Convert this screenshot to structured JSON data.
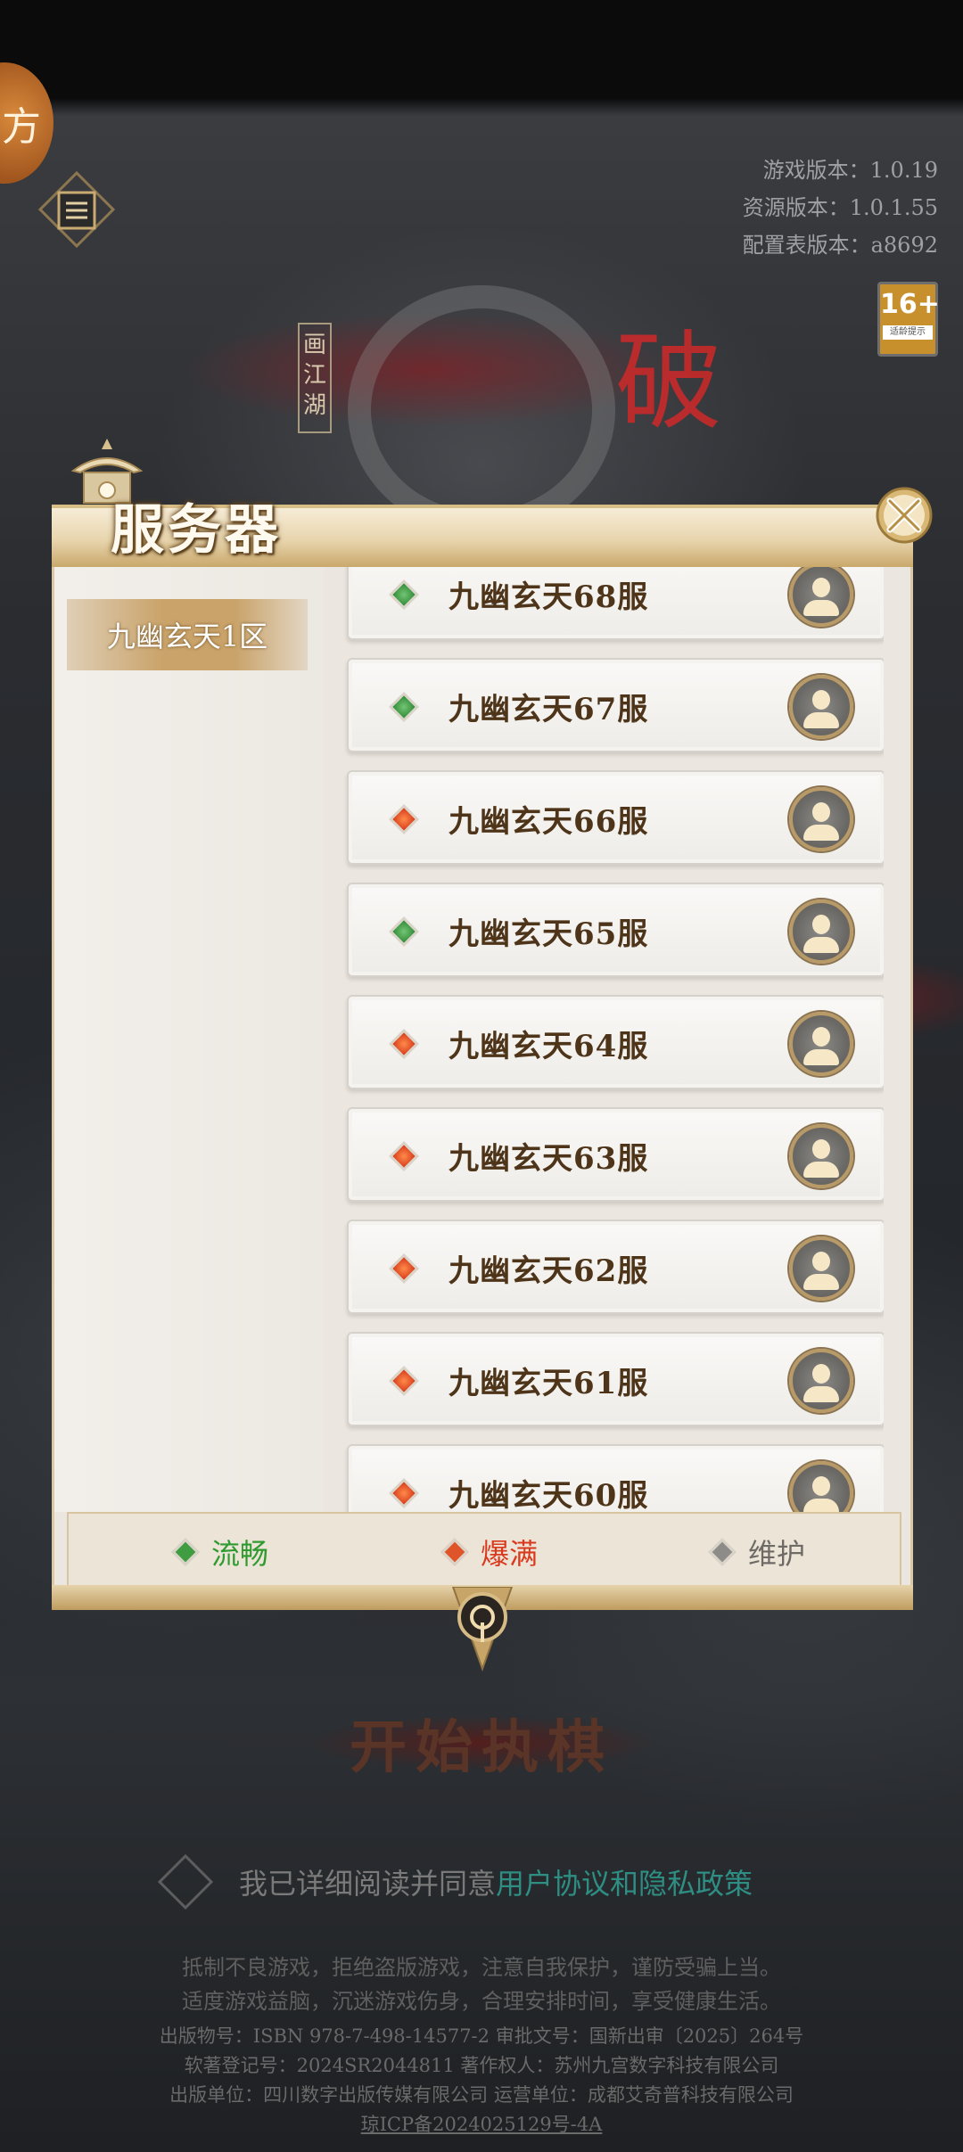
{
  "corner_badge": "方",
  "version": {
    "game": "游戏版本：1.0.19",
    "resource": "资源版本：1.0.1.55",
    "config": "配置表版本：a8692"
  },
  "age_rating": {
    "label": "16+",
    "tip": "适龄提示"
  },
  "logo": {
    "vertical": "画江湖",
    "red": "破"
  },
  "dialog": {
    "title": "服务器",
    "zone_tab": "九幽玄天1区",
    "servers": [
      {
        "name": "九幽玄天68服",
        "status": "smooth"
      },
      {
        "name": "九幽玄天67服",
        "status": "smooth"
      },
      {
        "name": "九幽玄天66服",
        "status": "full"
      },
      {
        "name": "九幽玄天65服",
        "status": "smooth"
      },
      {
        "name": "九幽玄天64服",
        "status": "full"
      },
      {
        "name": "九幽玄天63服",
        "status": "full"
      },
      {
        "name": "九幽玄天62服",
        "status": "full"
      },
      {
        "name": "九幽玄天61服",
        "status": "full"
      },
      {
        "name": "九幽玄天60服",
        "status": "full"
      }
    ],
    "legend": {
      "smooth": "流畅",
      "full": "爆满",
      "maintenance": "维护"
    }
  },
  "start_button": "开始执棋",
  "agreement": {
    "prefix": "我已详细阅读并同意",
    "link": "用户协议和隐私政策"
  },
  "notice": {
    "line1": "抵制不良游戏，拒绝盗版游戏，注意自我保护，谨防受骗上当。",
    "line2": "适度游戏益脑，沉迷游戏伤身，合理安排时间，享受健康生活。"
  },
  "license": {
    "line1": "出版物号：ISBN 978-7-498-14577-2 审批文号：国新出审〔2025〕264号",
    "line2": "软著登记号：2024SR2044811 著作权人：苏州九宫数字科技有限公司",
    "line3": "出版单位：四川数字出版传媒有限公司 运营单位：成都艾奇普科技有限公司",
    "icp": "琼ICP备2024025129号-4A"
  },
  "colors": {
    "smooth": "#3f9c41",
    "full": "#e0542a",
    "maintenance": "#8e8c89",
    "server_name": "#4e3419",
    "link": "#2e8e83"
  }
}
